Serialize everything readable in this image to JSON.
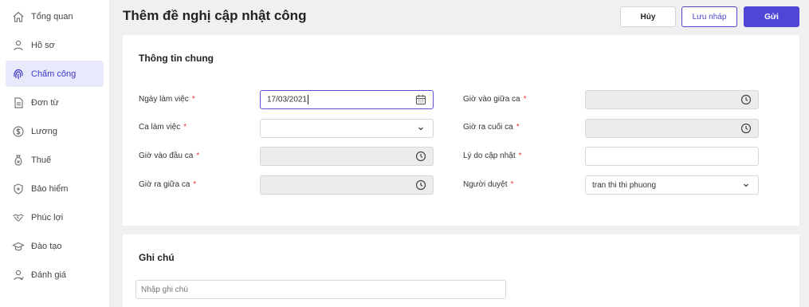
{
  "sidebar": {
    "items": [
      {
        "label": "Tổng quan",
        "icon": "home-icon"
      },
      {
        "label": "Hồ sơ",
        "icon": "user-icon"
      },
      {
        "label": "Chấm công",
        "icon": "fingerprint-icon",
        "active": true
      },
      {
        "label": "Đơn từ",
        "icon": "document-icon"
      },
      {
        "label": "Lương",
        "icon": "dollar-icon"
      },
      {
        "label": "Thuế",
        "icon": "tax-bag-icon"
      },
      {
        "label": "Bảo hiểm",
        "icon": "shield-icon"
      },
      {
        "label": "Phúc lợi",
        "icon": "handshake-icon"
      },
      {
        "label": "Đào tạo",
        "icon": "graduation-cap-icon"
      },
      {
        "label": "Đánh giá",
        "icon": "user-review-icon"
      }
    ]
  },
  "header": {
    "title": "Thêm đề nghị cập nhật công",
    "cancel_label": "Hủy",
    "draft_label": "Lưu nháp",
    "send_label": "Gửi"
  },
  "general": {
    "section_title": "Thông tin chung",
    "work_date": {
      "label": "Ngày làm việc",
      "value": "17/03/2021"
    },
    "shift": {
      "label": "Ca làm việc",
      "value": ""
    },
    "shift_start_in": {
      "label": "Giờ vào đầu ca",
      "value": ""
    },
    "mid_shift_out": {
      "label": "Giờ ra giữa ca",
      "value": ""
    },
    "mid_shift_in": {
      "label": "Giờ vào giữa ca",
      "value": ""
    },
    "shift_end_out": {
      "label": "Giờ ra cuối ca",
      "value": ""
    },
    "update_reason": {
      "label": "Lý do cập nhật",
      "value": ""
    },
    "approver": {
      "label": "Người duyệt",
      "value": "tran thi thi phuong"
    },
    "required_mark": "*"
  },
  "notes": {
    "section_title": "Ghi chú",
    "placeholder": "Nhập ghi chú",
    "value": ""
  },
  "colors": {
    "accent": "#5046d6",
    "active_nav_bg": "#e8e9fb",
    "required": "#e53935"
  }
}
